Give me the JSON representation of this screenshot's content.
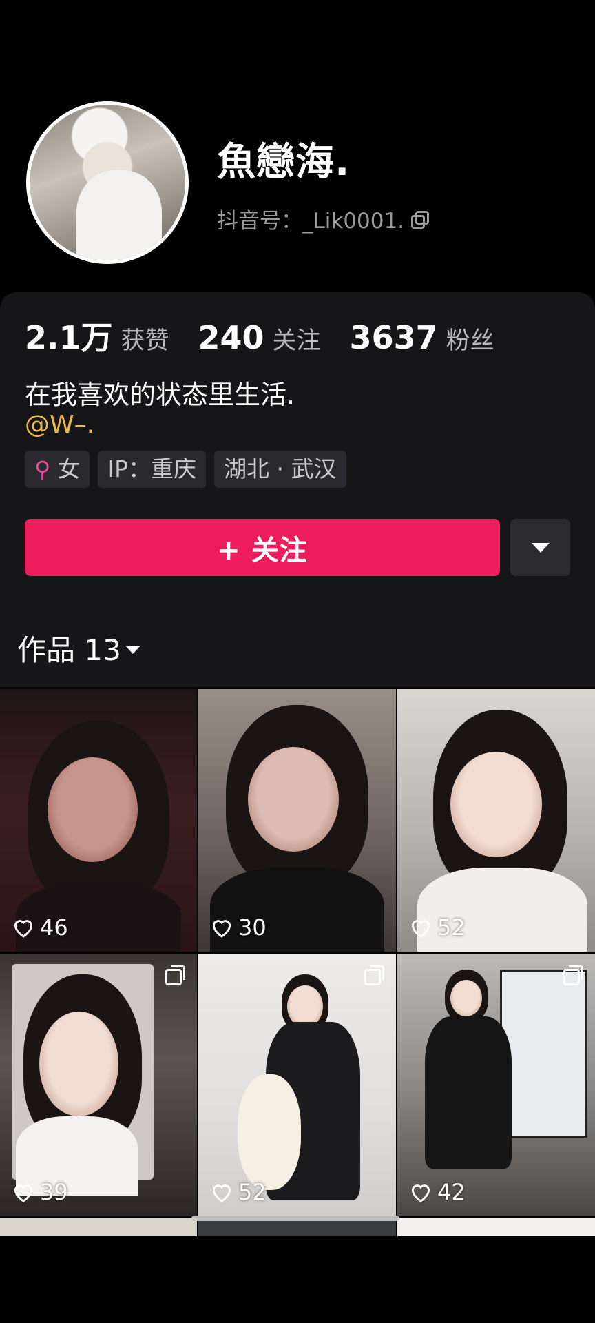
{
  "profile": {
    "name": "魚戀海.",
    "douyin_id": "抖音号：_Lik0001.",
    "copy_icon": "copy-icon"
  },
  "stats": [
    {
      "value": "2.1万",
      "label": "获赞"
    },
    {
      "value": "240",
      "label": "关注"
    },
    {
      "value": "3637",
      "label": "粉丝"
    }
  ],
  "bio": {
    "text": "在我喜欢的状态里生活.",
    "mention": "@W–."
  },
  "tags": [
    {
      "icon": "female-icon",
      "label": "女"
    },
    {
      "icon": "",
      "label": "IP：重庆"
    },
    {
      "icon": "",
      "label": "湖北 · 武汉"
    }
  ],
  "actions": {
    "follow_label": "+ 关注",
    "more_icon": "triangle-down-icon"
  },
  "works_tab": {
    "label": "作品 13"
  },
  "colors": {
    "accent": "#ec1c5d",
    "mention": "#e9b94a",
    "female": "#e64b9b",
    "card_bg": "#161618"
  },
  "videos": [
    {
      "likes": "46",
      "multi": false
    },
    {
      "likes": "30",
      "multi": false
    },
    {
      "likes": "52",
      "multi": false
    },
    {
      "likes": "39",
      "multi": true
    },
    {
      "likes": "52",
      "multi": true
    },
    {
      "likes": "42",
      "multi": true
    }
  ]
}
